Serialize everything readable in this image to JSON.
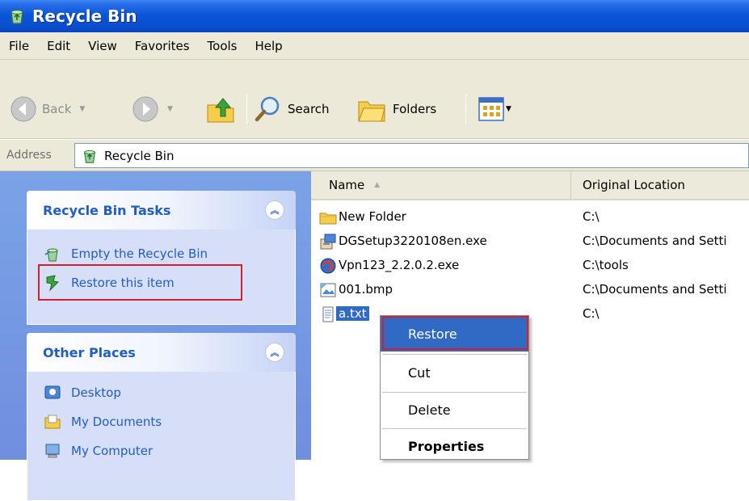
{
  "window": {
    "title": "Recycle Bin"
  },
  "menu": [
    "File",
    "Edit",
    "View",
    "Favorites",
    "Tools",
    "Help"
  ],
  "toolbar": {
    "back": "Back",
    "search": "Search",
    "folders": "Folders"
  },
  "address": {
    "label": "Address",
    "value": "Recycle Bin"
  },
  "tasks": {
    "title": "Recycle Bin Tasks",
    "items": [
      "Empty the Recycle Bin",
      "Restore this item"
    ]
  },
  "places": {
    "title": "Other Places",
    "items": [
      "Desktop",
      "My Documents",
      "My Computer"
    ]
  },
  "columns": {
    "name": "Name",
    "location": "Original Location"
  },
  "files": [
    {
      "name": "New Folder",
      "location": "C:\\",
      "icon": "folder-icon"
    },
    {
      "name": "DGSetup3220108en.exe",
      "location": "C:\\Documents and Setti",
      "icon": "installer-icon"
    },
    {
      "name": "Vpn123_2.2.0.2.exe",
      "location": "C:\\tools",
      "icon": "vpn-app-icon"
    },
    {
      "name": "001.bmp",
      "location": "C:\\Documents and Setti",
      "icon": "bitmap-icon"
    },
    {
      "name": "a.txt",
      "location": "C:\\",
      "icon": "text-file-icon"
    }
  ],
  "context_menu": [
    "Restore",
    "Cut",
    "Delete",
    "Properties"
  ],
  "colors": {
    "title_bar": "#0a55d8",
    "selection": "#316ac5",
    "highlight_box": "#d2202f",
    "task_pane": "#7ba2e7",
    "link": "#215dc6"
  }
}
